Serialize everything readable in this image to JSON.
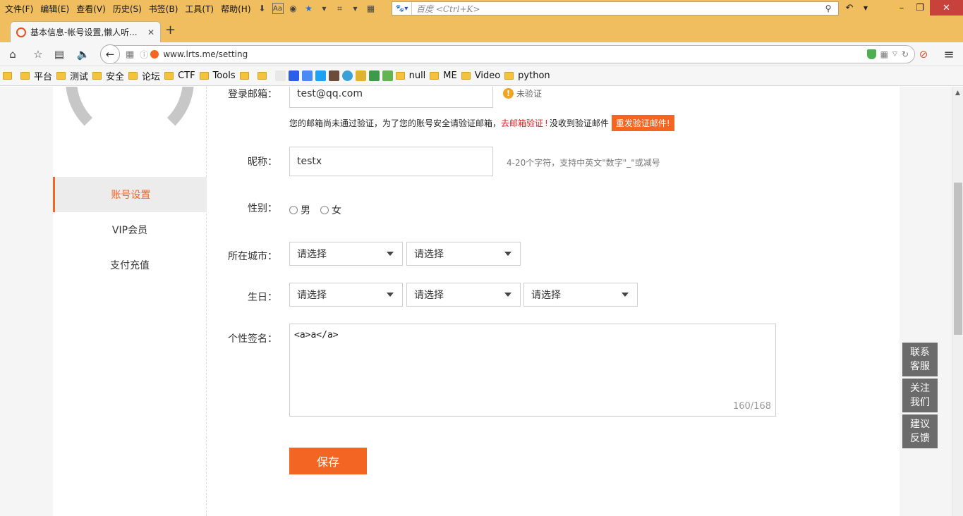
{
  "menubar": {
    "items": [
      "文件(F)",
      "编辑(E)",
      "查看(V)",
      "历史(S)",
      "书签(B)",
      "工具(T)",
      "帮助(H)"
    ],
    "search_placeholder": "百度 <Ctrl+K>"
  },
  "tabs": [
    {
      "title": "基本信息-帐号设置,懒人听..."
    }
  ],
  "url": "www.lrts.me/setting",
  "bookmarks": [
    "平台",
    "测试",
    "安全",
    "论坛",
    "CTF",
    "Tools",
    "null",
    "ME",
    "Video",
    "python"
  ],
  "sidebar": {
    "items": [
      {
        "label": "账号设置",
        "active": true
      },
      {
        "label": "VIP会员",
        "active": false
      },
      {
        "label": "支付充值",
        "active": false
      }
    ]
  },
  "form": {
    "email": {
      "label": "登录邮箱：",
      "value": "test@qq.com",
      "status": "未验证"
    },
    "verify_notice": {
      "text": "您的邮箱尚未通过验证，为了您的账号安全请验证邮箱，",
      "link": "去邮箱验证",
      "text2": "没收到验证邮件",
      "button": "重发验证邮件!"
    },
    "nickname": {
      "label": "昵称：",
      "value": "testx",
      "hint": "4-20个字符，支持中英文\"数字\"_\"或减号"
    },
    "gender": {
      "label": "性别：",
      "options": [
        "男",
        "女"
      ]
    },
    "city": {
      "label": "所在城市：",
      "selects": [
        "请选择",
        "请选择"
      ]
    },
    "birthday": {
      "label": "生日：",
      "selects": [
        "请选择",
        "请选择",
        "请选择"
      ]
    },
    "signature": {
      "label": "个性签名：",
      "value": "<a>a</a>",
      "counter": "160/168"
    },
    "save_label": "保存"
  },
  "float_buttons": [
    {
      "line1": "联系",
      "line2": "客服"
    },
    {
      "line1": "关注",
      "line2": "我们"
    },
    {
      "line1": "建议",
      "line2": "反馈"
    }
  ],
  "colors": {
    "accent": "#f26522",
    "menubar": "#f0be5e",
    "float": "#6b6b6b"
  }
}
